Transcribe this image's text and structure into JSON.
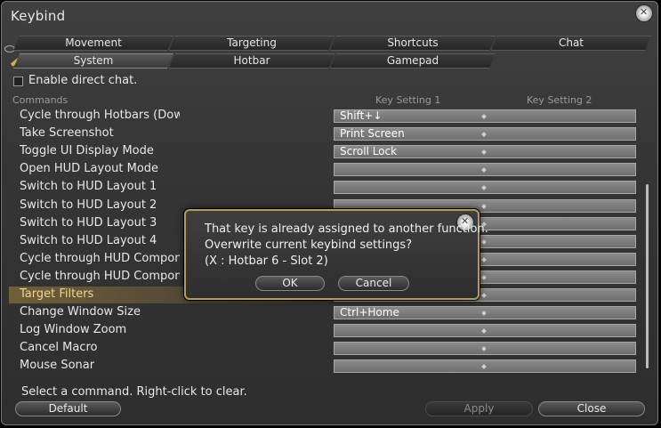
{
  "window": {
    "title": "Keybind"
  },
  "tabs_row1": [
    "Movement",
    "Targeting",
    "Shortcuts",
    "Chat"
  ],
  "tabs_row2": [
    "System",
    "Hotbar",
    "Gamepad"
  ],
  "enable_direct_chat": "Enable direct chat.",
  "columns": {
    "commands": "Commands",
    "key1": "Key Setting 1",
    "key2": "Key Setting 2"
  },
  "rows": [
    {
      "command": "Cycle through Hotbars (Down)",
      "key1": "Shift+↓"
    },
    {
      "command": "Take Screenshot",
      "key1": "Print Screen"
    },
    {
      "command": "Toggle UI Display Mode",
      "key1": "Scroll Lock"
    },
    {
      "command": "Open HUD Layout Mode",
      "key1": ""
    },
    {
      "command": "Switch to HUD Layout 1",
      "key1": ""
    },
    {
      "command": "Switch to HUD Layout 2",
      "key1": ""
    },
    {
      "command": "Switch to HUD Layout 3",
      "key1": ""
    },
    {
      "command": "Switch to HUD Layout 4",
      "key1": ""
    },
    {
      "command": "Cycle through HUD Components",
      "key1": ""
    },
    {
      "command": "Cycle through HUD Components",
      "key1": ""
    },
    {
      "command": "Target Filters",
      "key1": ""
    },
    {
      "command": "Change Window Size",
      "key1": "Ctrl+Home"
    },
    {
      "command": "Log Window Zoom",
      "key1": ""
    },
    {
      "command": "Cancel Macro",
      "key1": ""
    },
    {
      "command": "Mouse Sonar",
      "key1": ""
    }
  ],
  "hint": "Select a command. Right-click to clear.",
  "buttons": {
    "default": "Default",
    "apply": "Apply",
    "close": "Close"
  },
  "dialog": {
    "line1": "That key is already assigned to another function.",
    "line2": "Overwrite current keybind settings?",
    "line3": "(X : Hotbar 6 - Slot 2)",
    "ok": "OK",
    "cancel": "Cancel"
  },
  "colors": {
    "accent_gold": "#b79a5a",
    "highlight_text": "#f0d68e"
  }
}
